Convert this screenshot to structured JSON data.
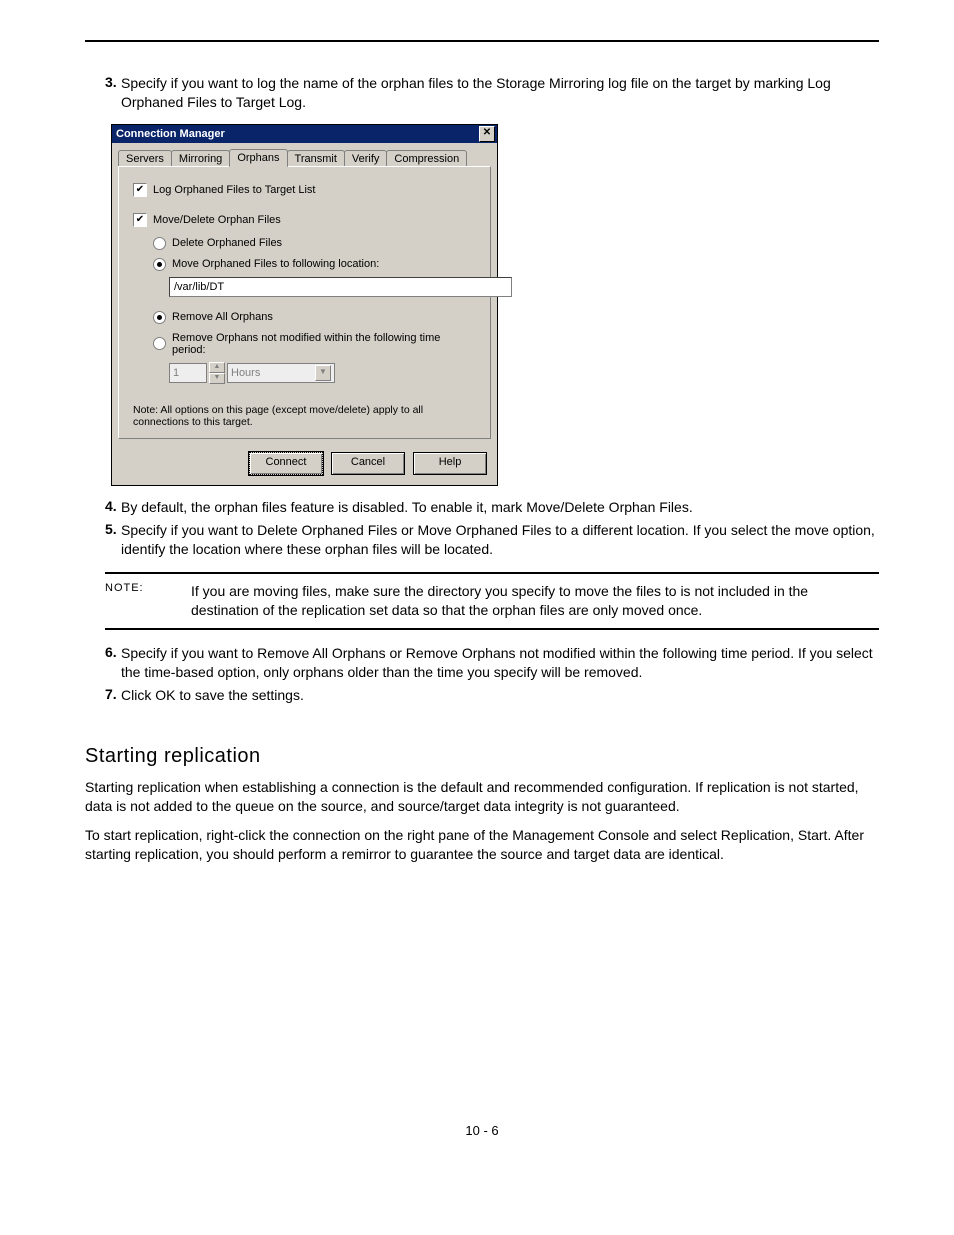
{
  "step3": {
    "marker": "3.",
    "text": "Specify if you want to log the name of the orphan files to the Storage Mirroring log file on the target by marking Log Orphaned Files to Target Log."
  },
  "dialog": {
    "title": "Connection Manager",
    "tabs": [
      "Servers",
      "Mirroring",
      "Orphans",
      "Transmit",
      "Verify",
      "Compression"
    ],
    "selected_tab": 2,
    "chk_log": {
      "checked": true,
      "label": "Log Orphaned Files to Target List"
    },
    "chk_movedel": {
      "checked": true,
      "label": "Move/Delete Orphan Files"
    },
    "radio_delete": {
      "selected": false,
      "label": "Delete Orphaned Files"
    },
    "radio_move": {
      "selected": true,
      "label": "Move Orphaned Files to following location:"
    },
    "path_value": "/var/lib/DT",
    "radio_removeall": {
      "selected": true,
      "label": "Remove All Orphans"
    },
    "radio_removetime": {
      "selected": false,
      "label": "Remove Orphans not modified within the following time period:"
    },
    "time_value": "1",
    "time_unit": "Hours",
    "note": "Note: All options on this page (except move/delete) apply to all connections to this target.",
    "buttons": {
      "connect": "Connect",
      "cancel": "Cancel",
      "help": "Help"
    }
  },
  "step4": {
    "marker": "4.",
    "text": "By default, the orphan files feature is disabled. To enable it, mark Move/Delete Orphan Files."
  },
  "step5": {
    "marker": "5.",
    "text": "Specify if you want to Delete Orphaned Files or Move Orphaned Files to a different location. If you select the move option, identify the location where these orphan files will be located."
  },
  "note_block": {
    "label": "NOTE:",
    "body": "If you are moving files, make sure the directory you specify to move the files to is not included in the destination of the replication set data so that the orphan files are only moved once."
  },
  "step6": {
    "marker": "6.",
    "text": "Specify if you want to Remove All Orphans or Remove Orphans not modified within the following time period. If you select the time-based option, only orphans older than the time you specify will be removed."
  },
  "step7": {
    "marker": "7.",
    "text": "Click OK to save the settings."
  },
  "section": {
    "title": "Starting replication",
    "p1": "Starting replication when establishing a connection is the default and recommended configuration. If replication is not started, data is not added to the queue on the source, and source/target data integrity is not guaranteed.",
    "p2": "To start replication, right-click the connection on the right pane of the Management Console and select Replication, Start. After starting replication, you should perform a remirror to guarantee the source and target data are identical."
  },
  "footer": "10 - 6"
}
